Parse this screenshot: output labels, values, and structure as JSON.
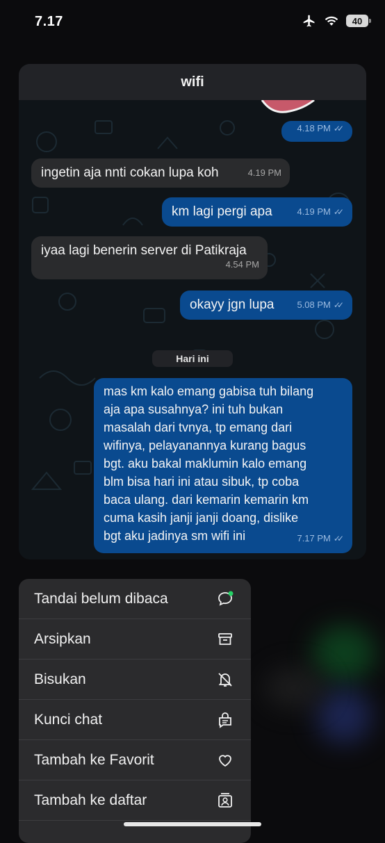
{
  "statusbar": {
    "time": "7.17",
    "battery": "40"
  },
  "chat": {
    "title": "wifi",
    "day_separator": "Hari ini",
    "messages": [
      {
        "dir": "out",
        "text": "",
        "time": "4.18 PM",
        "read": true
      },
      {
        "dir": "in",
        "text": "ingetin aja nnti cokan lupa koh",
        "time": "4.19 PM"
      },
      {
        "dir": "out",
        "text": "km lagi pergi apa",
        "time": "4.19 PM",
        "read": true
      },
      {
        "dir": "in",
        "text": "iyaa lagi benerin server di Patikraja",
        "time": "4.54 PM"
      },
      {
        "dir": "out",
        "text": "okayy jgn lupa",
        "time": "5.08 PM",
        "read": true
      },
      {
        "dir": "out",
        "text": "mas km kalo emang gabisa tuh bilang\naja apa susahnya? ini tuh bukan\nmasalah dari tvnya, tp emang dari\nwifinya, pelayanannya kurang bagus\nbgt. aku bakal maklumin kalo emang\nblm bisa hari ini atau sibuk, tp coba\nbaca ulang. dari kemarin kemarin km\ncuma kasih janji janji doang, dislike\nbgt aku jadinya sm wifi ini",
        "time": "7.17 PM",
        "read": true
      }
    ]
  },
  "menu": {
    "items": [
      {
        "label": "Tandai belum dibaca",
        "icon": "unread-chat-icon"
      },
      {
        "label": "Arsipkan",
        "icon": "archive-icon"
      },
      {
        "label": "Bisukan",
        "icon": "mute-bell-icon"
      },
      {
        "label": "Kunci chat",
        "icon": "lock-chat-icon"
      },
      {
        "label": "Tambah ke Favorit",
        "icon": "heart-icon"
      },
      {
        "label": "Tambah ke daftar",
        "icon": "add-to-list-icon"
      }
    ]
  },
  "colors": {
    "incoming": "#2a2b2d",
    "outgoing": "#0a4a8f",
    "menu_bg": "#2b2b2d",
    "unread_dot": "#25d366"
  }
}
